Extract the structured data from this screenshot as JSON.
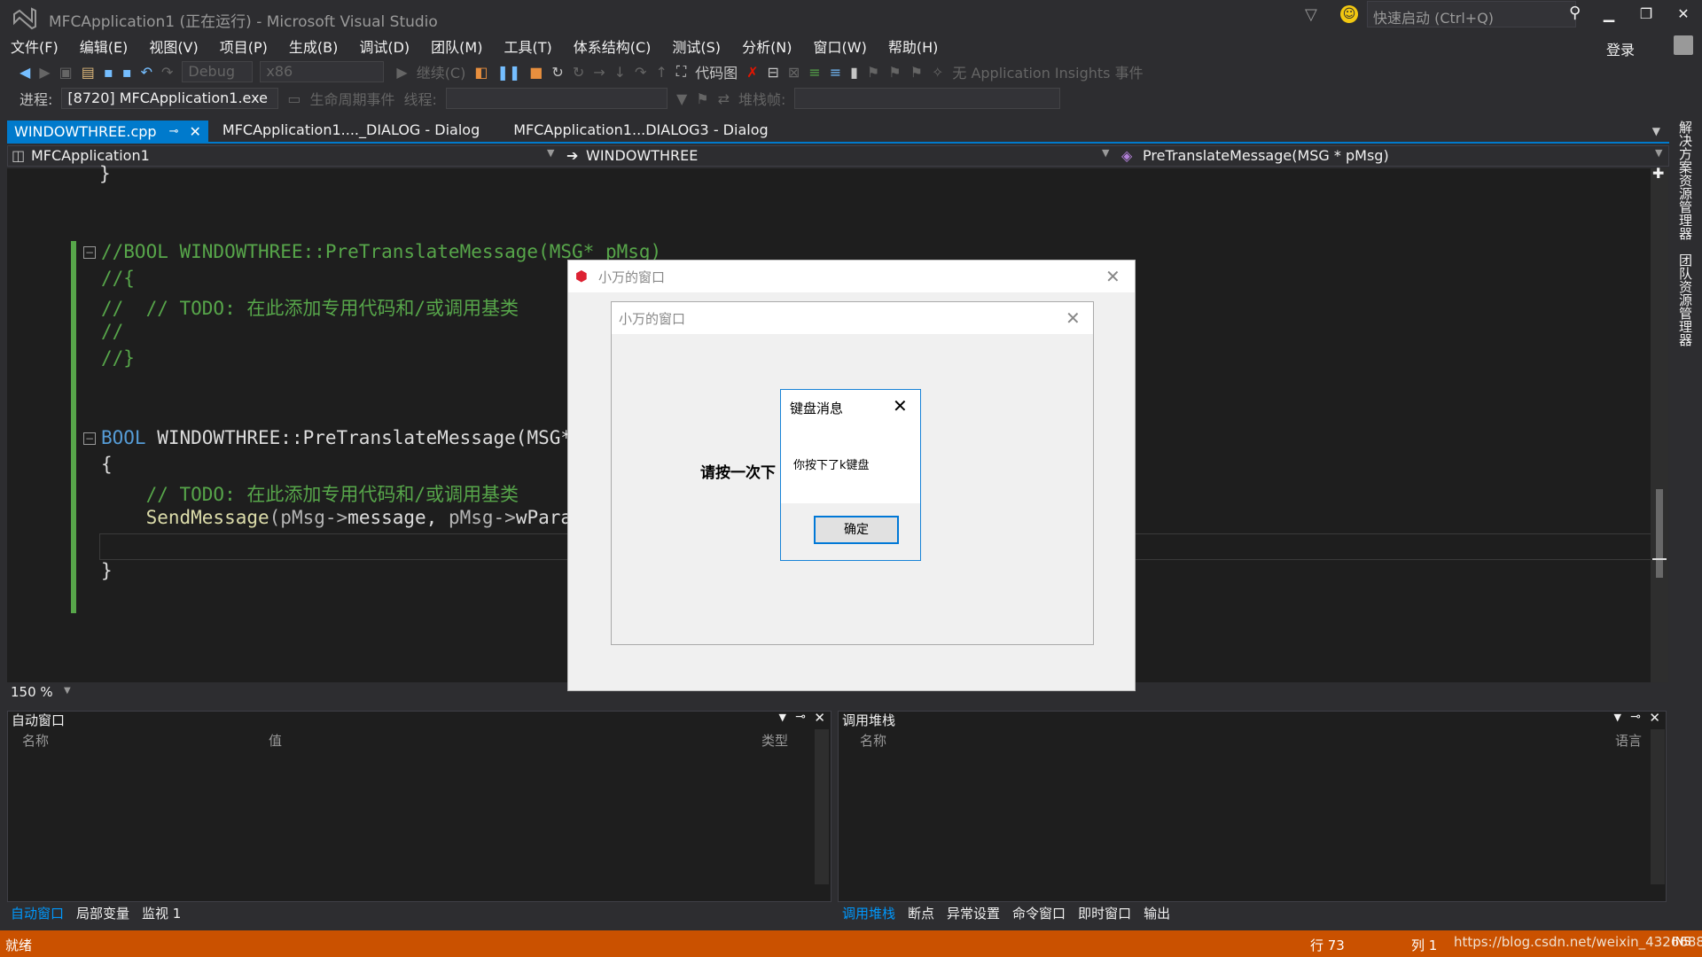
{
  "app": {
    "title": "MFCApplication1 (正在运行) - Microsoft Visual Studio",
    "quick_launch_placeholder": "快速启动 (Ctrl+Q)",
    "login": "登录"
  },
  "menu": [
    "文件(F)",
    "编辑(E)",
    "视图(V)",
    "项目(P)",
    "生成(B)",
    "调试(D)",
    "团队(M)",
    "工具(T)",
    "体系结构(C)",
    "测试(S)",
    "分析(N)",
    "窗口(W)",
    "帮助(H)"
  ],
  "toolbar": {
    "config": "Debug",
    "platform": "x86",
    "continue": "继续(C)",
    "code_map": "代码图",
    "insights": "无 Application Insights 事件"
  },
  "debug_bar": {
    "process_label": "进程:",
    "process_value": "[8720] MFCApplication1.exe",
    "lifecycle": "生命周期事件",
    "thread_label": "线程:",
    "stackframe_label": "堆栈帧:"
  },
  "tabs": [
    "WINDOWTHREE.cpp",
    "MFCApplication1...._DIALOG - Dialog",
    "MFCApplication1...DIALOG3 - Dialog"
  ],
  "navbar": {
    "project": "MFCApplication1",
    "class": "WINDOWTHREE",
    "member": "PreTranslateMessage(MSG * pMsg)"
  },
  "code": {
    "l0": "}",
    "l1": "//BOOL WINDOWTHREE::PreTranslateMessage(MSG* pMsg)",
    "l2": "//{",
    "l3": "//  // TODO: 在此添加专用代码和/或调用基类",
    "l4": "//",
    "l5": "//}",
    "l6a": "BOOL",
    "l6b": " WINDOWTHREE::PreTranslateMessage(MSG* ",
    "l7": "{",
    "l8": "    // TODO: 在此添加专用代码和/或调用基类",
    "l9a": "    SendMessage",
    "l9b": "(pMsg->",
    "l9c": "message, ",
    "l9d": "pMsg->",
    "l9e": "wParam",
    "l10": "}"
  },
  "zoom": "150 %",
  "dialog_outer": {
    "title": "小万的窗口"
  },
  "dialog_inner": {
    "title": "小万的窗口",
    "text": "请按一次下"
  },
  "msgbox": {
    "title": "键盘消息",
    "text": "你按下了k键盘",
    "ok": "确定"
  },
  "auto_panel": {
    "title": "自动窗口",
    "cols": [
      "名称",
      "值",
      "类型"
    ],
    "tabs": [
      "自动窗口",
      "局部变量",
      "监视 1"
    ]
  },
  "call_panel": {
    "title": "调用堆栈",
    "cols": [
      "名称",
      "语言"
    ],
    "tabs": [
      "调用堆栈",
      "断点",
      "异常设置",
      "命令窗口",
      "即时窗口",
      "输出"
    ]
  },
  "status": {
    "ready": "就绪",
    "line": "行 73",
    "col": "列 1",
    "url": "https://blog.csdn.net/weixin_43266881",
    "ins": "INS"
  },
  "side": {
    "solution": "解决方案资源管理器",
    "team": "团队资源管理器"
  }
}
